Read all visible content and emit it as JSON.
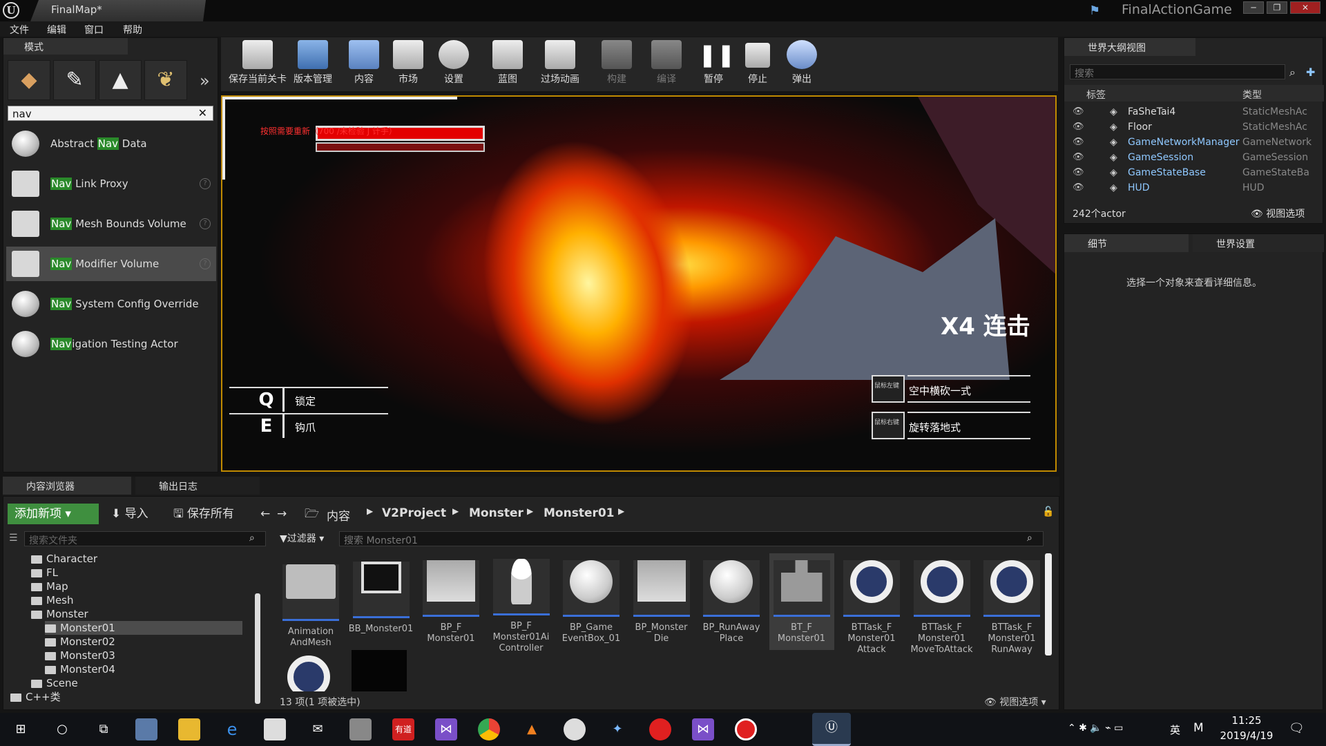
{
  "window": {
    "doc_tab": "FinalMap*",
    "game_title": "FinalActionGame"
  },
  "menu": [
    "文件",
    "编辑",
    "窗口",
    "帮助"
  ],
  "modes": {
    "tab": "模式",
    "search": "nav",
    "items": [
      {
        "pre": "Abstract ",
        "hl": "Nav",
        "post": " Data"
      },
      {
        "pre": "",
        "hl": "Nav",
        "post": " Link Proxy"
      },
      {
        "pre": "",
        "hl": "Nav",
        "post": " Mesh Bounds Volume"
      },
      {
        "pre": "",
        "hl": "Nav",
        "post": " Modifier Volume"
      },
      {
        "pre": "",
        "hl": "Nav",
        "post": " System Config Override"
      },
      {
        "pre": "",
        "hl": "Nav",
        "post": "igation Testing Actor"
      }
    ]
  },
  "toolbar": {
    "save": "保存当前关卡",
    "source": "版本管理",
    "content": "内容",
    "market": "市场",
    "settings": "设置",
    "blueprint": "蓝图",
    "cinematics": "过场动画",
    "build": "构建",
    "compile": "编译",
    "pause": "暂停",
    "stop": "停止",
    "eject": "弹出"
  },
  "viewport": {
    "combo": "X4 连击",
    "hp_text": "按照需要重新（700 /未检验 J 计手）",
    "keys": [
      {
        "key": "Q",
        "label": "锁定"
      },
      {
        "key": "E",
        "label": "钩爪"
      }
    ],
    "skills": [
      {
        "key": "鼠标左键",
        "label": "空中横砍一式"
      },
      {
        "key": "鼠标右键",
        "label": "旋转落地式"
      }
    ]
  },
  "outliner": {
    "tab": "世界大纲视图",
    "search": "搜索",
    "col_label": "标签",
    "col_type": "类型",
    "rows": [
      {
        "name": "FaSheTai4",
        "type": "StaticMeshAc"
      },
      {
        "name": "Floor",
        "type": "StaticMeshAc"
      },
      {
        "name": "GameNetworkManager",
        "type": "GameNetwork"
      },
      {
        "name": "GameSession",
        "type": "GameSession"
      },
      {
        "name": "GameStateBase",
        "type": "GameStateBa"
      },
      {
        "name": "HUD",
        "type": "HUD"
      }
    ],
    "count": "242个actor",
    "view": "视图选项"
  },
  "details": {
    "tab1": "细节",
    "tab2": "世界设置",
    "msg": "选择一个对象来查看详细信息。"
  },
  "content": {
    "tab1": "内容浏览器",
    "tab2": "输出日志",
    "add": "添加新项",
    "import": "导入",
    "save_all": "保存所有",
    "crumbs": [
      "内容",
      "V2Project",
      "Monster",
      "Monster01"
    ],
    "folder_search": "搜索文件夹",
    "filter": "过滤器",
    "asset_search": "搜索 Monster01",
    "tree": [
      "Character",
      "FL",
      "Map",
      "Mesh",
      "Monster",
      "Monster01",
      "Monster02",
      "Monster03",
      "Monster04",
      "Scene",
      "C++类"
    ],
    "assets": [
      "Animation AndMesh",
      "BB_Monster01",
      "BP_F Monster01",
      "BP_F Monster01Ai Controller",
      "BP_Game EventBox_01",
      "BP_Monster Die",
      "BP_RunAway Place",
      "BT_F Monster01",
      "BTTask_F Monster01 Attack",
      "BTTask_F Monster01 MoveToAttack",
      "BTTask_F Monster01 RunAway"
    ],
    "status": "13 项(1 项被选中)",
    "view": "视图选项"
  },
  "taskbar": {
    "time": "11:25",
    "date": "2019/4/19",
    "ime": "英"
  }
}
